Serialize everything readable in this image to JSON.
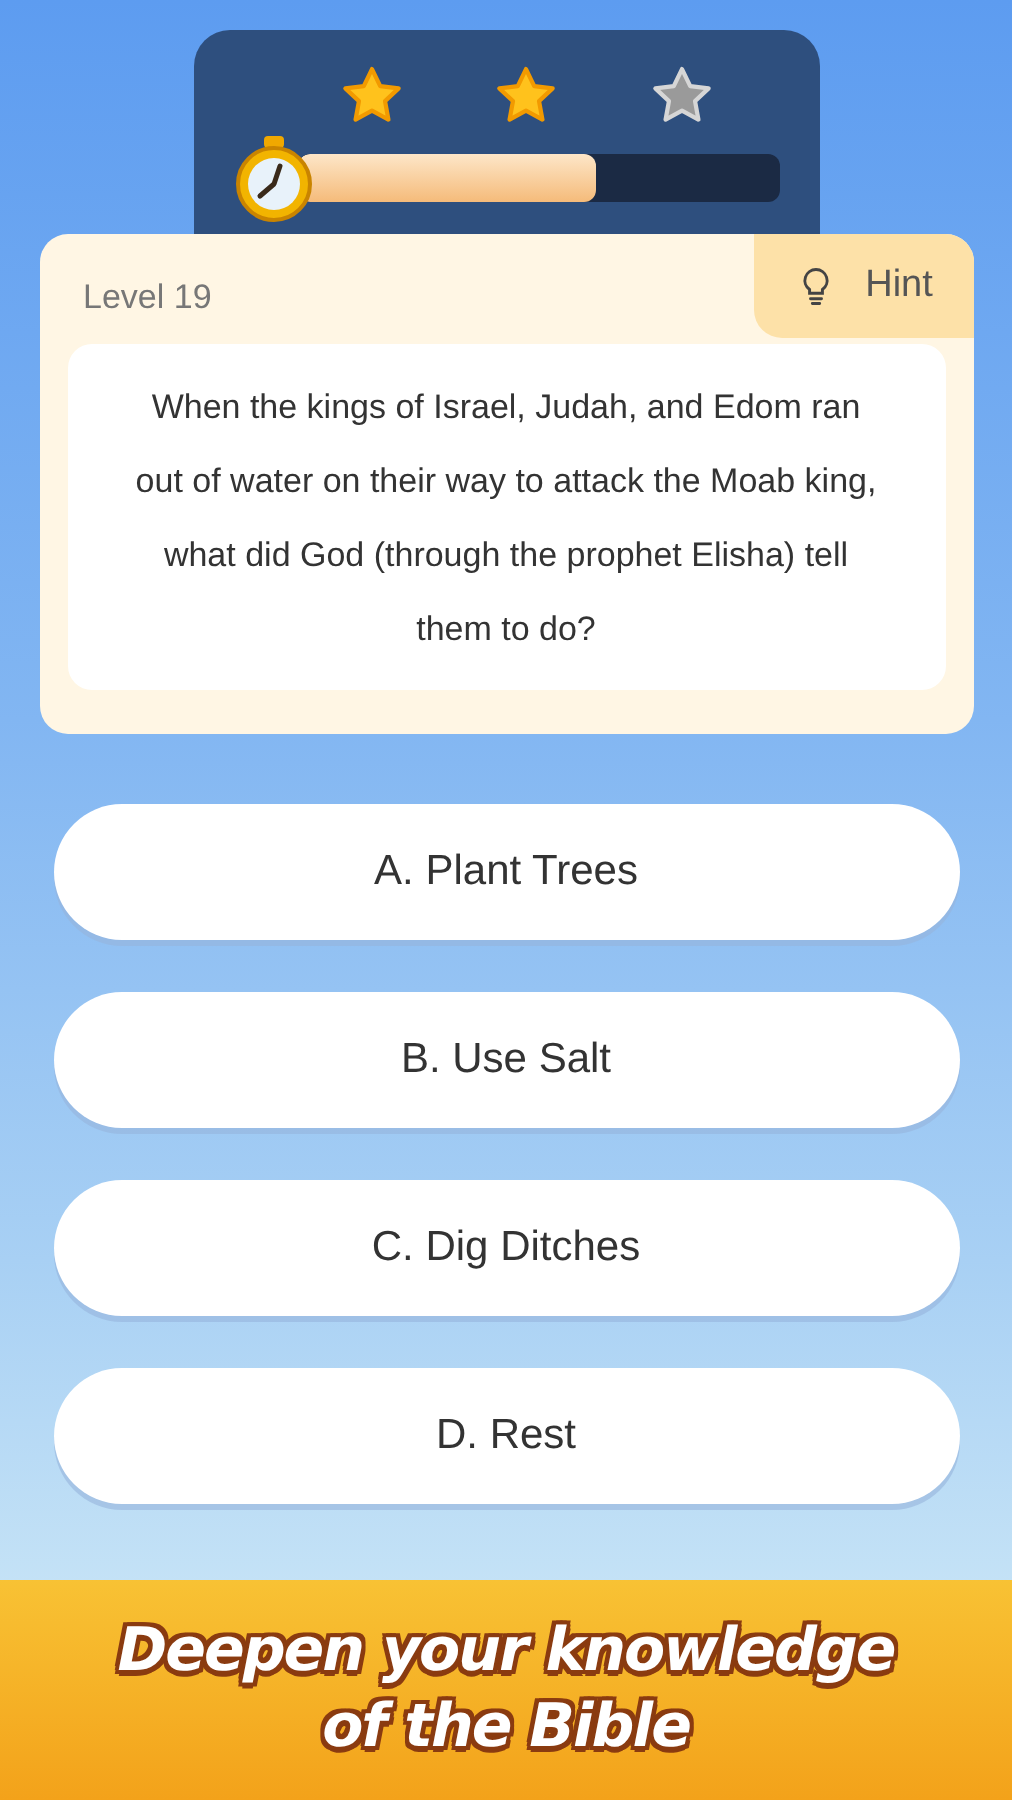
{
  "progress": {
    "stars": 2,
    "level": 0.62
  },
  "question": {
    "level_label": "Level 19",
    "hint_label": "Hint",
    "text": "When the kings of Israel, Judah, and Edom ran out of water on their way to attack the Moab king, what did God (through the prophet Elisha) tell them to do?"
  },
  "answers": [
    {
      "label": "A. Plant Trees"
    },
    {
      "label": "B. Use Salt"
    },
    {
      "label": "C. Dig Ditches"
    },
    {
      "label": "D. Rest"
    }
  ],
  "banner": {
    "text": "Deepen your knowledge\nof  the Bible"
  }
}
